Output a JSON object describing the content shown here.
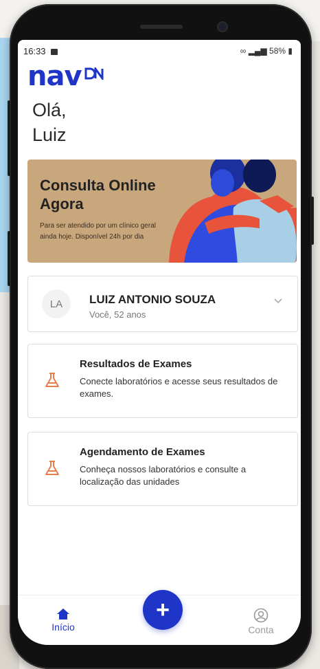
{
  "status_bar": {
    "time": "16:33",
    "battery": "58%"
  },
  "app": {
    "logo_text": "nav"
  },
  "greeting": {
    "line1": "Olá,",
    "line2": "Luiz"
  },
  "banner": {
    "title": "Consulta Online Agora",
    "subtitle": "Para ser atendido por um clínico geral ainda hoje. Disponível 24h por dia"
  },
  "user": {
    "initials": "LA",
    "name": "LUIZ ANTONIO SOUZA",
    "subtitle": "Você, 52 anos"
  },
  "cards": [
    {
      "title": "Resultados de Exames",
      "desc": "Conecte laboratórios e acesse seus resultados de exames."
    },
    {
      "title": "Agendamento de Exames",
      "desc": "Conheça nossos laboratórios e consulte a localização das unidades"
    }
  ],
  "tabbar": {
    "home_label": "Início",
    "fab_label": "+",
    "account_label": "Conta"
  },
  "colors": {
    "brand": "#1e35c8",
    "banner_bg": "#c9a77d",
    "flask": "#e87e4a"
  }
}
